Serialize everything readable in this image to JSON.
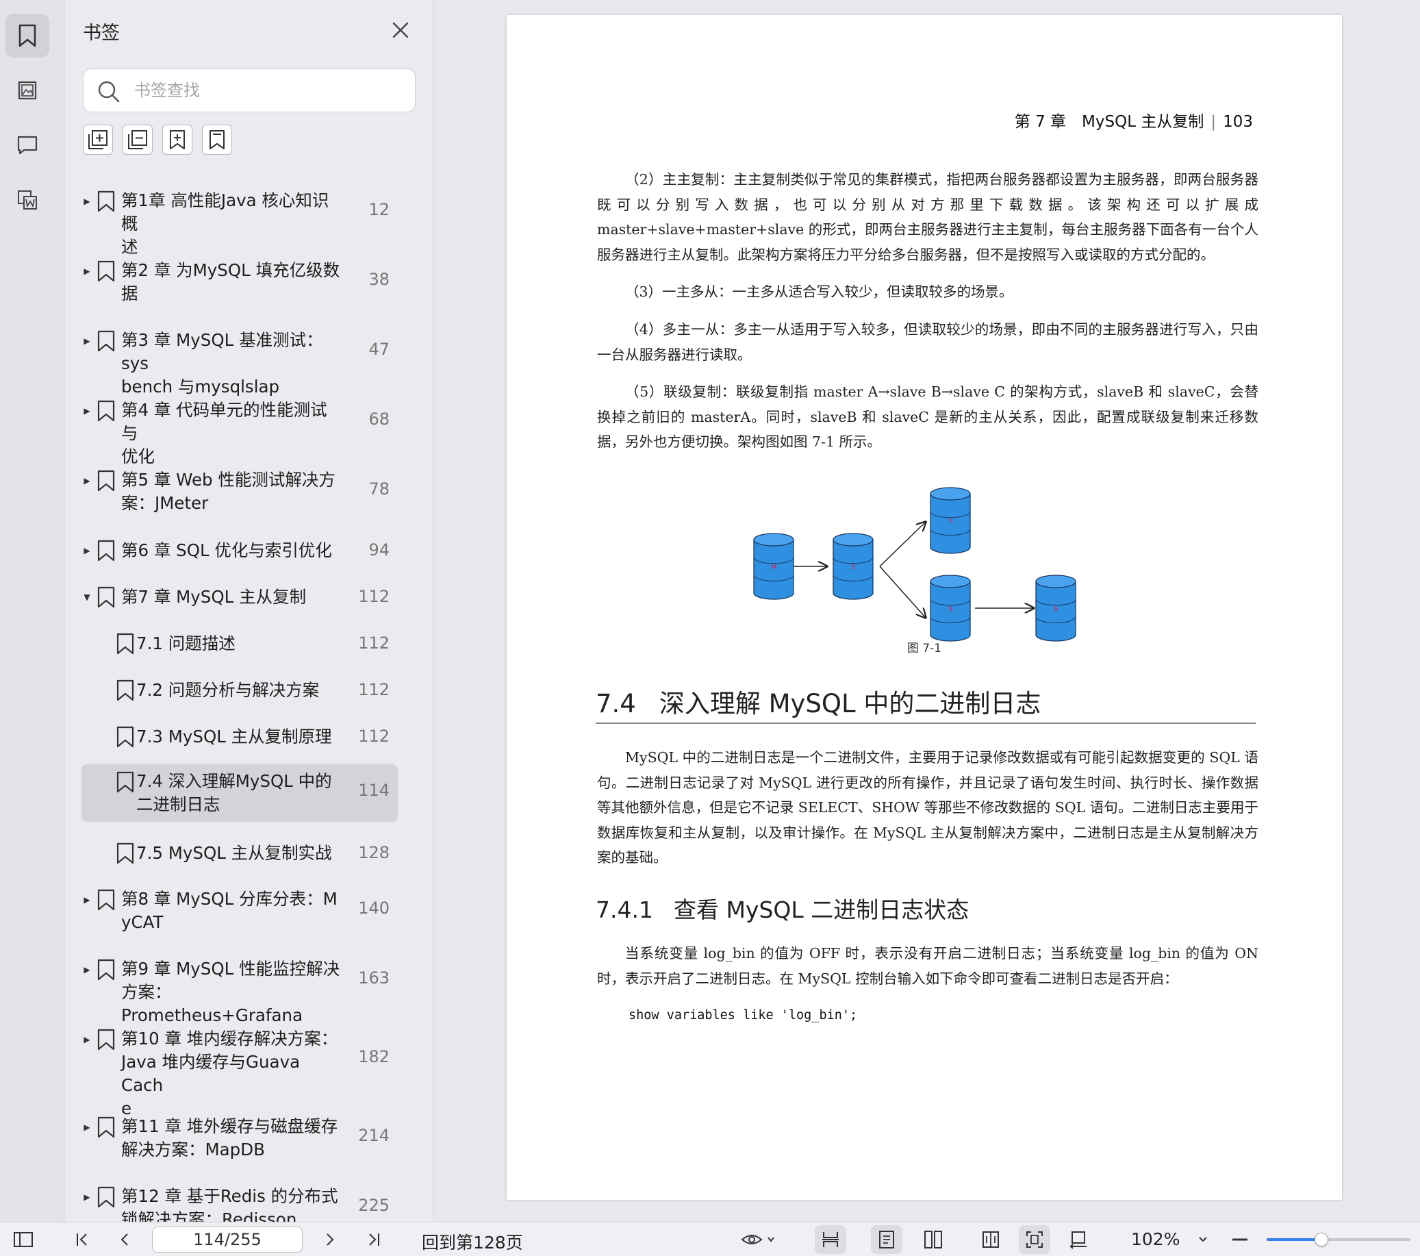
{
  "sidebar": {
    "title": "书签",
    "search_placeholder": "书签查找",
    "items": [
      {
        "label": "第1章 高性能Java 核心知识概\n述",
        "page": "12",
        "expanded": false
      },
      {
        "label": "第2 章 为MySQL 填充亿级数\n据",
        "page": "38",
        "expanded": false
      },
      {
        "label": "第3 章 MySQL 基准测试：sys\nbench 与mysqlslap",
        "page": "47",
        "expanded": false
      },
      {
        "label": "第4 章 代码单元的性能测试与\n优化",
        "page": "68",
        "expanded": false
      },
      {
        "label": "第5 章 Web 性能测试解决方\n案：JMeter",
        "page": "78",
        "expanded": false
      },
      {
        "label": "第6 章 SQL 优化与索引优化",
        "page": "94",
        "expanded": false
      },
      {
        "label": "第7 章 MySQL 主从复制",
        "page": "112",
        "expanded": true
      },
      {
        "label": "7.1 问题描述",
        "page": "112",
        "child": true
      },
      {
        "label": "7.2 问题分析与解决方案",
        "page": "112",
        "child": true
      },
      {
        "label": "7.3 MySQL 主从复制原理",
        "page": "112",
        "child": true
      },
      {
        "label": "7.4 深入理解MySQL 中的\n二进制日志",
        "page": "114",
        "child": true,
        "selected": true
      },
      {
        "label": "7.5 MySQL 主从复制实战",
        "page": "128",
        "child": true
      },
      {
        "label": "第8 章 MySQL 分库分表：M\nyCAT",
        "page": "140",
        "expanded": false
      },
      {
        "label": "第9 章 MySQL 性能监控解决\n方案：Prometheus+Grafana",
        "page": "163",
        "expanded": false
      },
      {
        "label": "第10 章 堆内缓存解决方案：\nJava 堆内缓存与Guava Cach\ne",
        "page": "182",
        "expanded": false
      },
      {
        "label": "第11 章 堆外缓存与磁盘缓存\n解决方案：MapDB",
        "page": "214",
        "expanded": false
      },
      {
        "label": "第12 章 基于Redis 的分布式\n锁解决方案：Redisson",
        "page": "225",
        "expanded": false
      }
    ]
  },
  "document": {
    "chapter_head": "第 7 章　MySQL 主从复制",
    "page_number": "103",
    "paragraphs": [
      "（2）主主复制：主主复制类似于常见的集群模式，指把两台服务器都设置为主服务器，即两台服务器既可以分别写入数据，也可以分别从对方那里下载数据。该架构还可以扩展成 master+slave+master+slave 的形式，即两台主服务器进行主主复制，每台主服务器下面各有一台个人服务器进行主从复制。此架构方案将压力平分给多台服务器，但不是按照写入或读取的方式分配的。",
      "（3）一主多从：一主多从适合写入较少，但读取较多的场景。",
      "（4）多主一从：多主一从适用于写入较多，但读取较少的场景，即由不同的主服务器进行写入，只由一台从服务器进行读取。",
      "（5）联级复制：联级复制指 master A→slave B→slave C 的架构方式，slaveB 和 slaveC，会替换掉之前旧的 masterA。同时，slaveB 和 slaveC 是新的主从关系，因此，配置成联级复制来迁移数据，另外也方便切换。架构图如图 7-1 所示。"
    ],
    "figure": {
      "caption": "图 7-1",
      "nodes": [
        "M",
        "S",
        "S",
        "S",
        "S"
      ],
      "color": "#2f8fe0"
    },
    "section": {
      "number": "7.4",
      "title": "深入理解 MySQL 中的二进制日志"
    },
    "section_paragraph": "MySQL 中的二进制日志是一个二进制文件，主要用于记录修改数据或有可能引起数据变更的 SQL 语句。二进制日志记录了对 MySQL 进行更改的所有操作，并且记录了语句发生时间、执行时长、操作数据等其他额外信息，但是它不记录 SELECT、SHOW 等那些不修改数据的 SQL 语句。二进制日志主要用于数据库恢复和主从复制，以及审计操作。在 MySQL 主从复制解决方案中，二进制日志是主从复制解决方案的基础。",
    "subsection": {
      "number": "7.4.1",
      "title": "查看 MySQL 二进制日志状态"
    },
    "subsection_paragraph": "当系统变量 log_bin 的值为 OFF 时，表示没有开启二进制日志；当系统变量 log_bin 的值为 ON 时，表示开启了二进制日志。在 MySQL 控制台输入如下命令即可查看二进制日志是否开启：",
    "code": "show variables like 'log_bin';"
  },
  "bottom_bar": {
    "page_indicator": "114/255",
    "goto_label": "回到第128页",
    "zoom": "102%",
    "zoom_slider_fraction": 0.38
  },
  "colors": {
    "accent": "#3a7ee8",
    "sidebar_bg": "#ebeaee",
    "figure_blue": "#2f8fe0"
  }
}
